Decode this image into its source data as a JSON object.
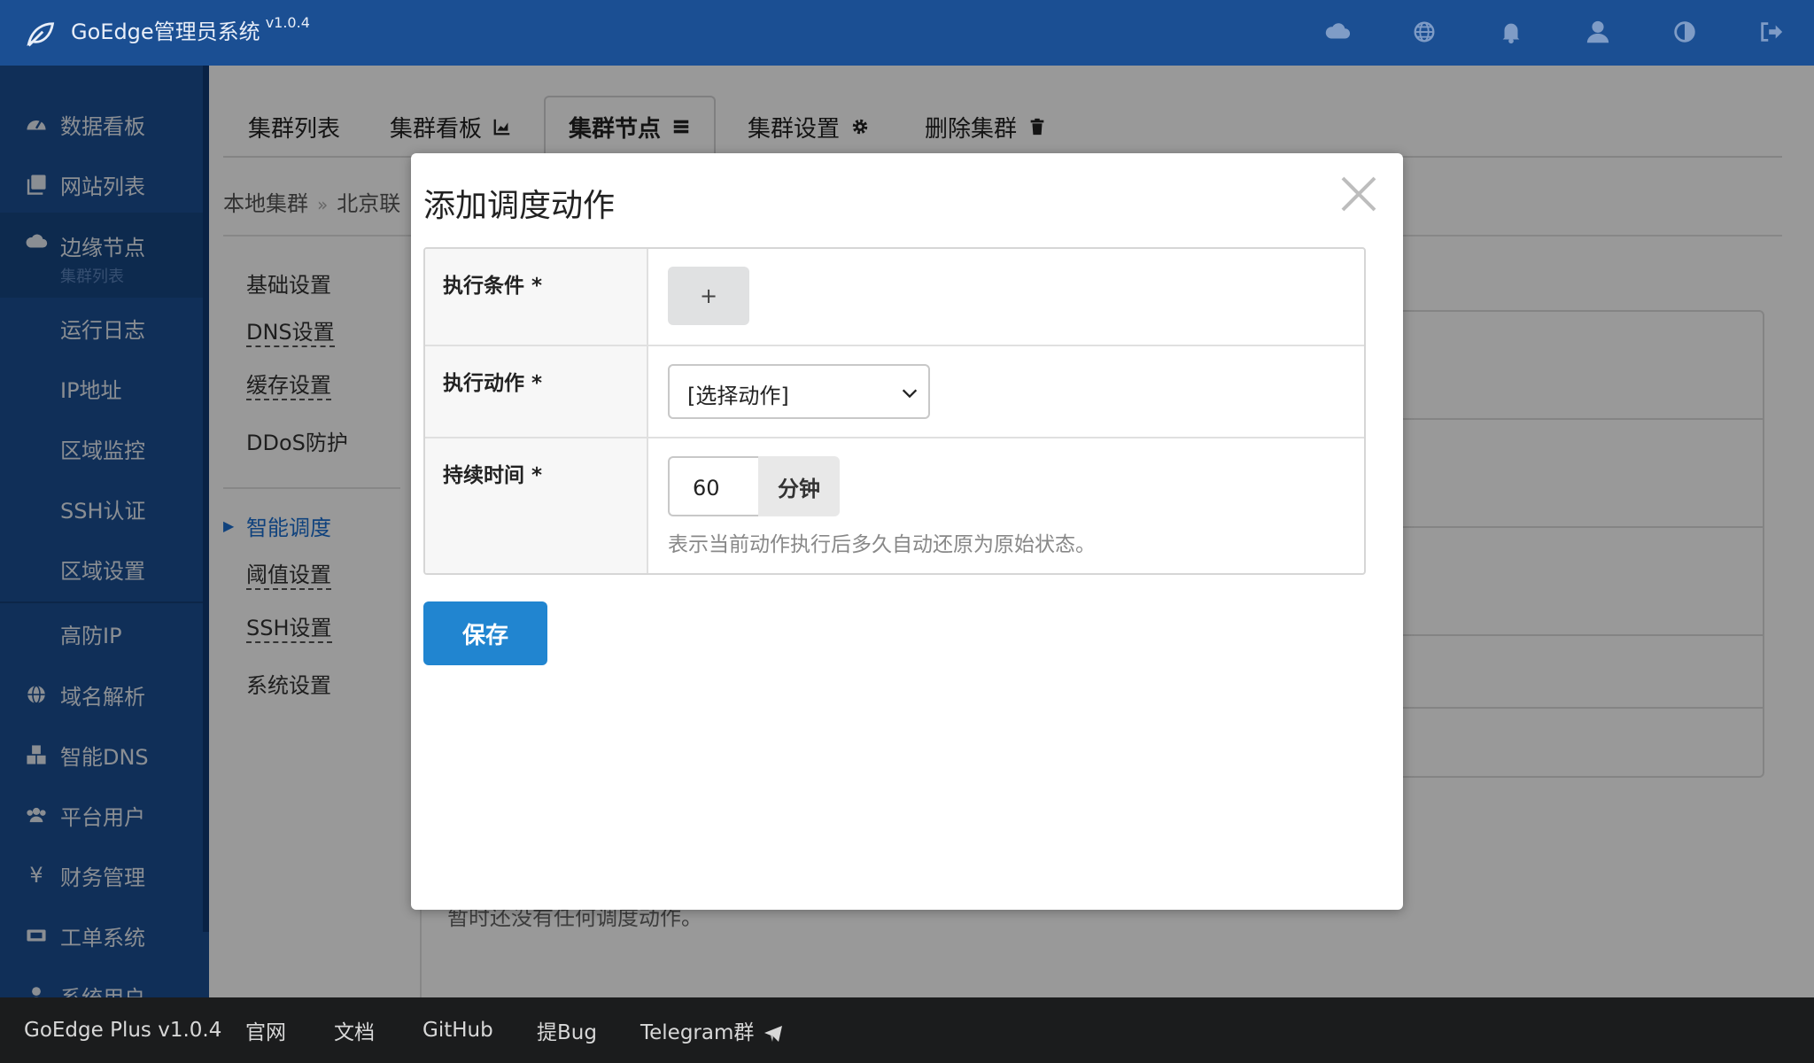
{
  "app": {
    "title": "GoEdge管理员系统",
    "version": "v1.0.4"
  },
  "topbar": {
    "icons": [
      "cloud-icon",
      "globe-icon",
      "bell-icon",
      "user-icon",
      "contrast-icon",
      "logout-icon"
    ]
  },
  "sidebar": {
    "items": [
      {
        "label": "数据看板",
        "icon": "dashboard-icon"
      },
      {
        "label": "网站列表",
        "icon": "clone-icon"
      },
      {
        "label": "边缘节点",
        "icon": "cloud-icon",
        "sub": "集群列表"
      },
      {
        "label": "运行日志"
      },
      {
        "label": "IP地址"
      },
      {
        "label": "区域监控"
      },
      {
        "label": "SSH认证"
      },
      {
        "label": "区域设置"
      },
      {
        "label": "高防IP"
      },
      {
        "label": "域名解析",
        "icon": "globe-icon"
      },
      {
        "label": "智能DNS",
        "icon": "cubes-icon"
      },
      {
        "label": "平台用户",
        "icon": "users-icon"
      },
      {
        "label": "财务管理",
        "icon": "yen-icon"
      },
      {
        "label": "工单系统",
        "icon": "ticket-icon"
      },
      {
        "label": "系统用户",
        "icon": "user-icon"
      }
    ]
  },
  "tabs": [
    {
      "label": "集群列表"
    },
    {
      "label": "集群看板"
    },
    {
      "label": "集群节点"
    },
    {
      "label": "集群设置"
    },
    {
      "label": "删除集群"
    }
  ],
  "breadcrumb": {
    "root": "本地集群",
    "sep": "»",
    "current": "北京联"
  },
  "leftmenu": [
    "基础设置",
    "DNS设置",
    "缓存设置",
    "DDoS防护",
    "智能调度",
    "阈值设置",
    "SSH设置",
    "系统设置"
  ],
  "background": {
    "empty_text": "暂时还没有任何调度动作。"
  },
  "modal": {
    "title": "添加调度动作",
    "rows": {
      "condition_label": "执行条件 *",
      "add_label": "+",
      "action_label": "执行动作 *",
      "action_select": "[选择动作]",
      "duration_label": "持续时间 *",
      "duration_value": "60",
      "duration_unit": "分钟",
      "duration_hint": "表示当前动作执行后多久自动还原为原始状态。"
    },
    "save": "保存"
  },
  "footer": {
    "brand": "GoEdge Plus v1.0.4",
    "links": [
      "官网",
      "文档",
      "GitHub",
      "提Bug",
      "Telegram群"
    ]
  },
  "colors": {
    "topbar": "#1b4f93",
    "primary": "#2185d0",
    "footer": "#1b1c1d"
  }
}
